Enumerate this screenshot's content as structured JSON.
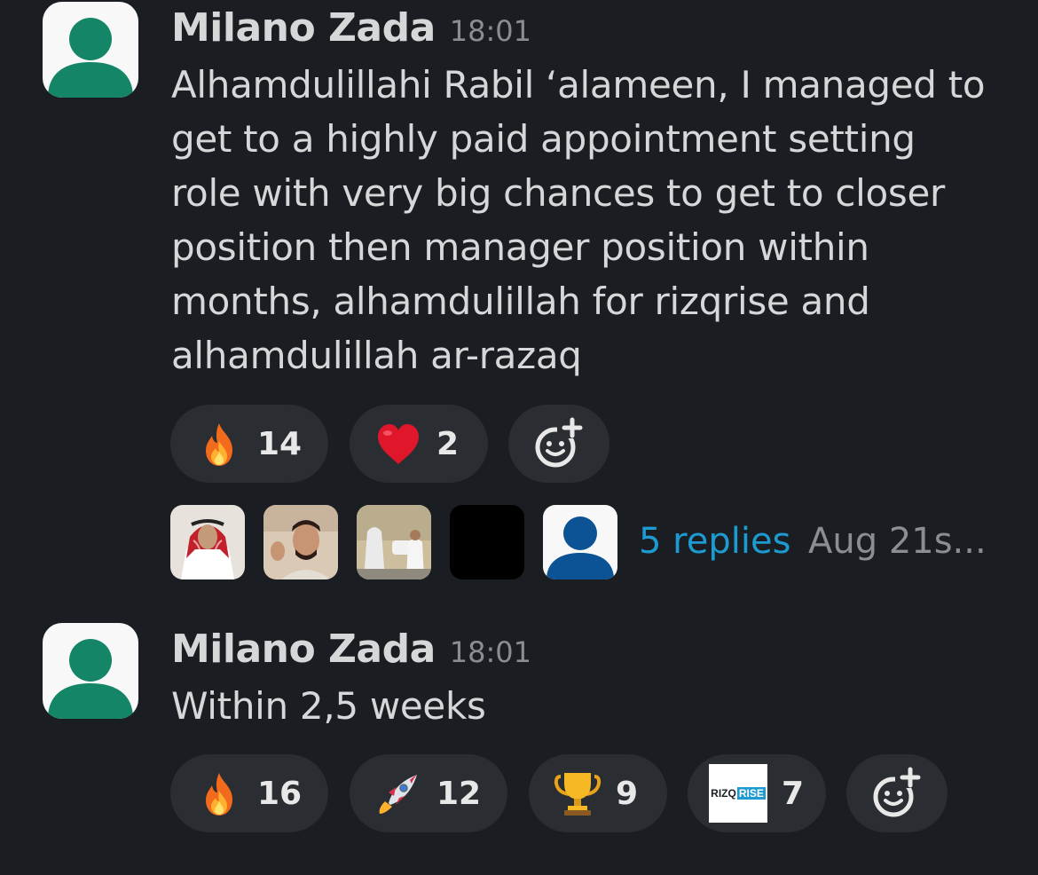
{
  "messages": [
    {
      "author": "Milano Zada",
      "time": "18:01",
      "text": "Alhamdulillahi Rabil ‘alameen, I managed to get to a highly paid appointment setting role with very big chances to get to closer position then manager position within months, alhamdulillah for rizqrise and alhamdulillah ar-razaq",
      "reactions": [
        {
          "emoji": "fire-emoji",
          "count": "14"
        },
        {
          "emoji": "red-heart-emoji",
          "count": "2"
        }
      ],
      "thread": {
        "replies_label": "5 replies",
        "last_reply": "Aug 21s..."
      }
    },
    {
      "author": "Milano Zada",
      "time": "18:01",
      "text": "Within 2,5 weeks",
      "reactions": [
        {
          "emoji": "fire-emoji",
          "count": "16"
        },
        {
          "emoji": "rocket-emoji",
          "count": "12"
        },
        {
          "emoji": "trophy-emoji",
          "count": "9"
        },
        {
          "emoji": "rizqrise-logo",
          "count": "7",
          "logo_text_a": "RIZQ",
          "logo_text_b": "RISE"
        }
      ]
    }
  ],
  "colors": {
    "background": "#1a1d21",
    "pill": "#2a2d31",
    "link": "#1d9bd1",
    "avatar_green": "#148567",
    "avatar_blue": "#0b5394"
  }
}
